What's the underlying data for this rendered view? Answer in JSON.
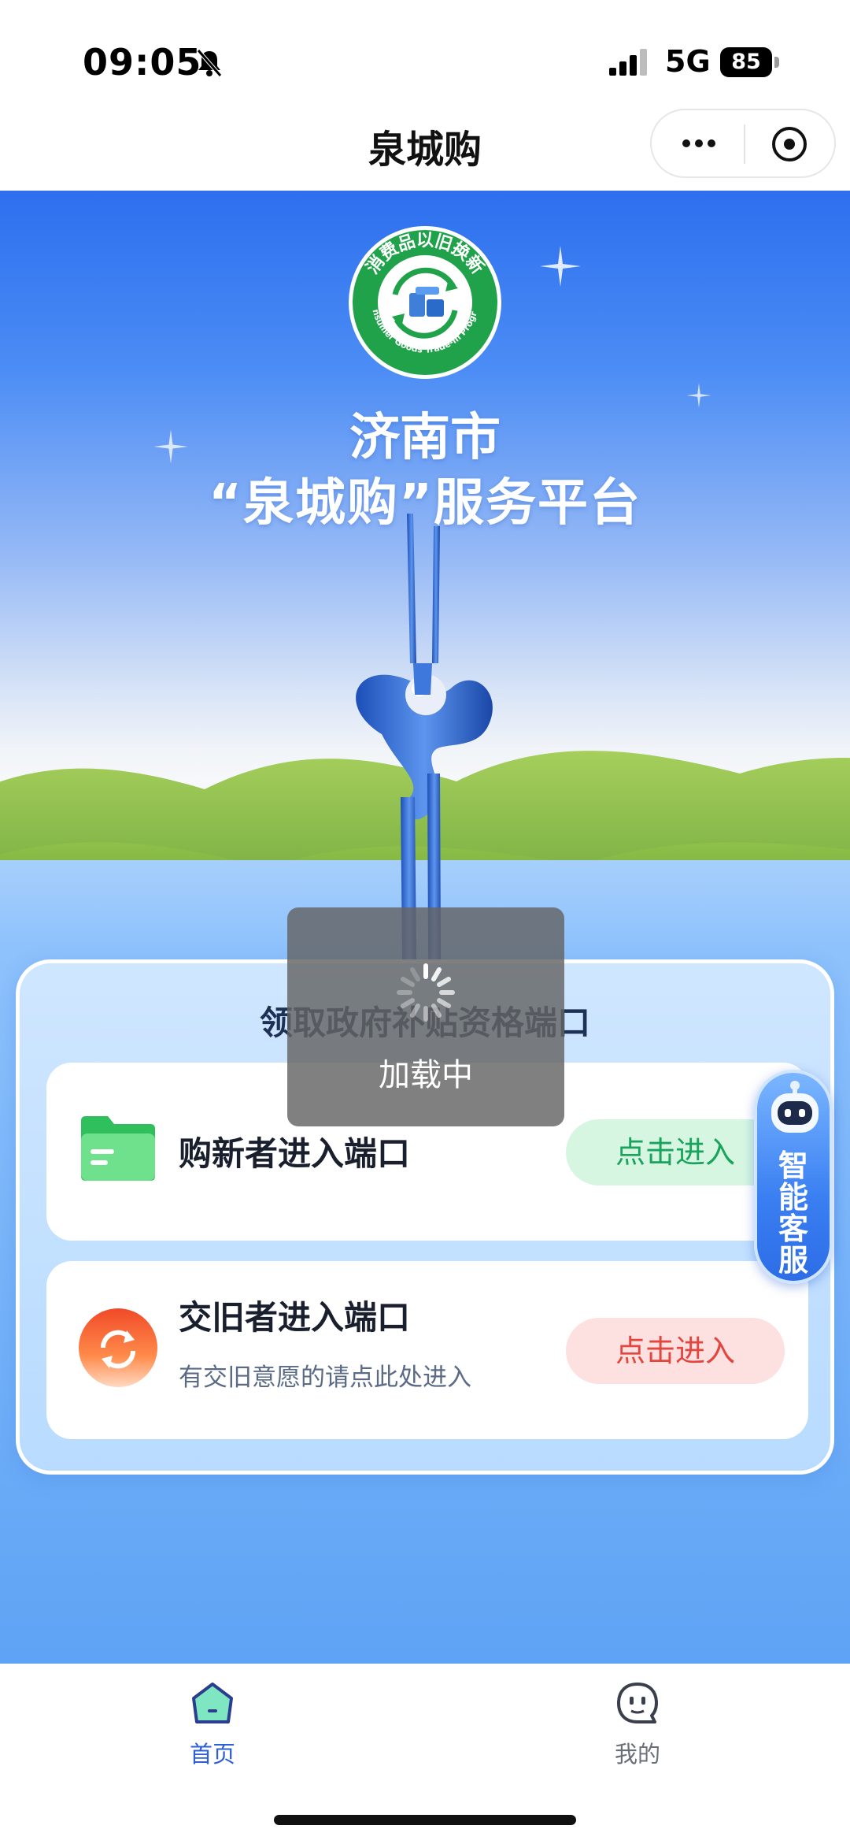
{
  "status_bar": {
    "time": "09:05",
    "network": "5G",
    "battery": "85",
    "icons": [
      "bell-muted-icon",
      "signal-icon",
      "battery-icon"
    ]
  },
  "nav": {
    "title": "泉城购",
    "more_icon": "more-dots-icon",
    "close_icon": "close-circle-icon"
  },
  "hero": {
    "badge_ring_text": "消费品以旧换新",
    "badge_english_text": "Consumer Goods Trade-in Program",
    "title_line1": "济南市",
    "title_line2": "“泉城购”服务平台"
  },
  "panel": {
    "heading": "领取政府补贴资格端口",
    "entries": [
      {
        "title": "购新者进入端口",
        "subtitle": "",
        "button": "点击进入",
        "icon": "folder-icon",
        "accent": "#1aa35c"
      },
      {
        "title": "交旧者进入端口",
        "subtitle": "有交旧意愿的请点此处进入",
        "button": "点击进入",
        "icon": "recycle-icon",
        "accent": "#e3463e"
      }
    ]
  },
  "assistant": {
    "label": "智能客服",
    "icon": "robot-icon"
  },
  "loading": {
    "text": "加载中"
  },
  "tabbar": {
    "items": [
      {
        "label": "首页",
        "icon": "home-icon",
        "active": true
      },
      {
        "label": "我的",
        "icon": "chat-face-icon",
        "active": false
      }
    ],
    "active_color": "#2f5fd8"
  }
}
